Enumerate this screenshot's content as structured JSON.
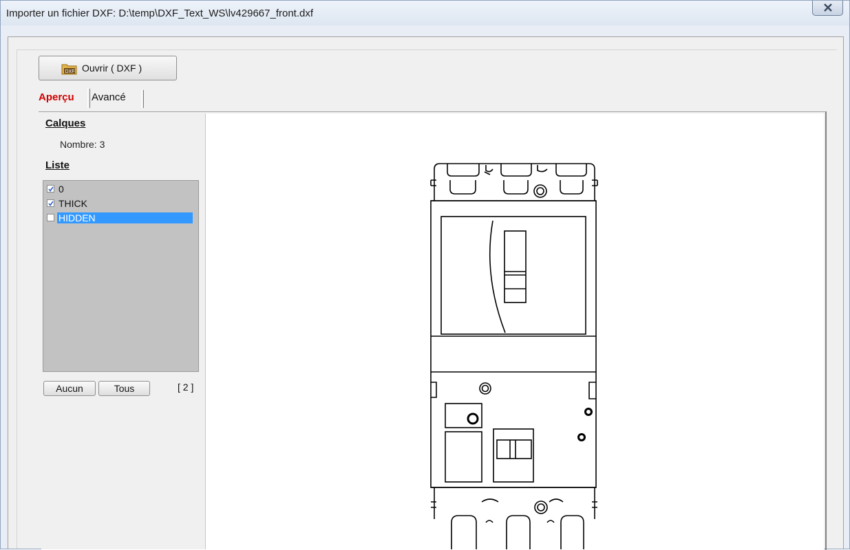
{
  "window": {
    "title": "Importer un fichier DXF: D:\\temp\\DXF_Text_WS\\lv429667_front.dxf"
  },
  "toolbar": {
    "open_label": "Ouvrir ( DXF )",
    "open_icon": "folder-dxf-icon"
  },
  "tabs": [
    {
      "label": "Aperçu",
      "active": true
    },
    {
      "label": "Avancé",
      "active": false
    }
  ],
  "layers": {
    "title": "Calques",
    "count_text": "Nombre: 3",
    "list_title": "Liste",
    "items": [
      {
        "name": "0",
        "checked": true,
        "selected": false
      },
      {
        "name": "THICK",
        "checked": true,
        "selected": false
      },
      {
        "name": "HIDDEN",
        "checked": false,
        "selected": true
      }
    ],
    "none_label": "Aucun",
    "all_label": "Tous",
    "selected_count": "[ 2 ]"
  },
  "colors": {
    "active_tab": "#d00000",
    "selection": "#3399ff",
    "list_bg": "#c2c2c2"
  }
}
